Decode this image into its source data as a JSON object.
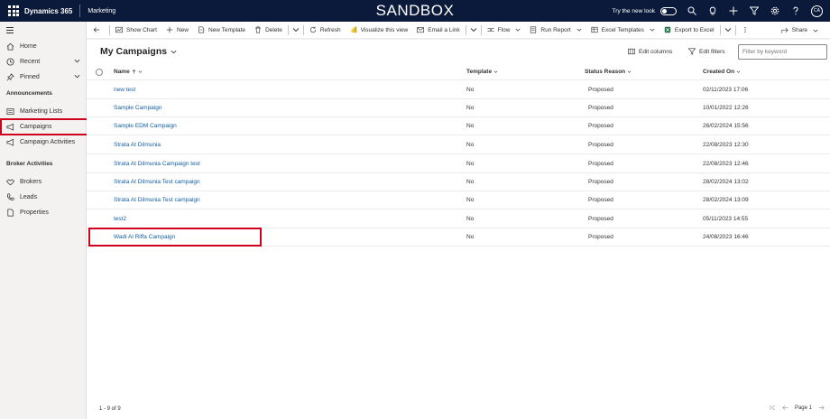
{
  "topbar": {
    "app_name": "Dynamics 365",
    "module": "Marketing",
    "environment": "SANDBOX",
    "try_new_look": "Try the new look",
    "avatar_initials": "CA",
    "bg_color": "#0b1a3a"
  },
  "sidebar": {
    "home": "Home",
    "recent": "Recent",
    "pinned": "Pinned",
    "announcements_heading": "Announcements",
    "marketing_lists": "Marketing Lists",
    "campaigns": "Campaigns",
    "campaign_activities": "Campaign Activities",
    "broker_heading": "Broker Activities",
    "brokers": "Brokers",
    "leads": "Leads",
    "properties": "Properties"
  },
  "commandbar": {
    "show_chart": "Show Chart",
    "new": "New",
    "new_template": "New Template",
    "delete": "Delete",
    "refresh": "Refresh",
    "visualize": "Visualize this view",
    "email_link": "Email a Link",
    "flow": "Flow",
    "run_report": "Run Report",
    "excel_templates": "Excel Templates",
    "export_excel": "Export to Excel",
    "share": "Share"
  },
  "view": {
    "title": "My Campaigns",
    "edit_columns": "Edit columns",
    "edit_filters": "Edit filters",
    "filter_placeholder": "Filter by keyword"
  },
  "grid": {
    "columns": {
      "name": "Name",
      "template": "Template",
      "status": "Status Reason",
      "created": "Created On"
    },
    "rows": [
      {
        "name": "new test",
        "template": "No",
        "status": "Proposed",
        "created": "02/11/2023 17:06"
      },
      {
        "name": "Sample Campaign",
        "template": "No",
        "status": "Proposed",
        "created": "10/01/2022 12:26"
      },
      {
        "name": "Sample EDM Campaign",
        "template": "No",
        "status": "Proposed",
        "created": "26/02/2024 15:56"
      },
      {
        "name": "Strata At Dilmunia",
        "template": "No",
        "status": "Proposed",
        "created": "22/08/2023 12:30"
      },
      {
        "name": "Strata At Dilmunia Campaign test",
        "template": "No",
        "status": "Proposed",
        "created": "22/08/2023 12:46"
      },
      {
        "name": "Strata At Dilmunia Test campaign",
        "template": "No",
        "status": "Proposed",
        "created": "28/02/2024 13:02"
      },
      {
        "name": "Strata At Dilmunia Test campaign",
        "template": "No",
        "status": "Proposed",
        "created": "28/02/2024 13:09"
      },
      {
        "name": "test2",
        "template": "No",
        "status": "Proposed",
        "created": "05/11/2023 14:55"
      },
      {
        "name": "Wadi Al Riffa Campaign",
        "template": "No",
        "status": "Proposed",
        "created": "24/08/2023 16:46"
      }
    ]
  },
  "footer": {
    "count": "1 - 9 of 9",
    "page": "Page 1"
  },
  "highlight_color": "#d0021b"
}
